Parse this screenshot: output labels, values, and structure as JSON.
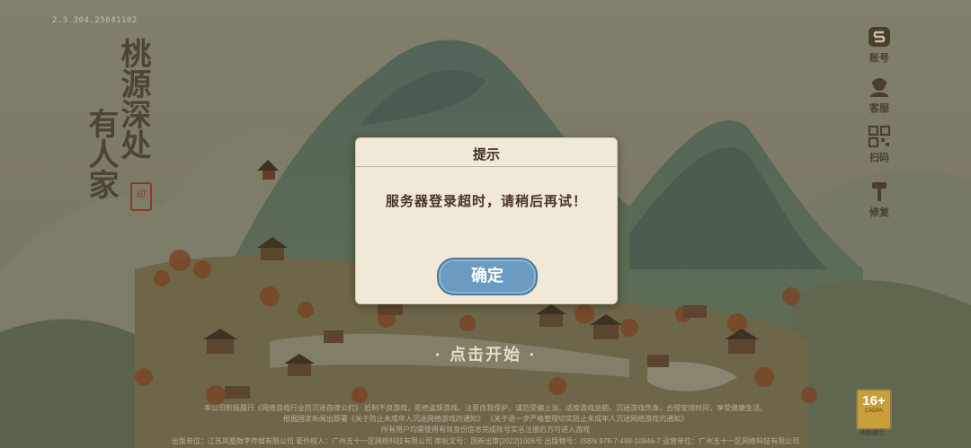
{
  "version": "2.3.304.25041102",
  "logo": {
    "col1": "桃源深处",
    "col2": "有人家",
    "seal": "印"
  },
  "side_menu": [
    {
      "label": "账号",
      "icon": "account-icon"
    },
    {
      "label": "客服",
      "icon": "customer-service-icon"
    },
    {
      "label": "扫码",
      "icon": "qr-code-icon"
    },
    {
      "label": "修复",
      "icon": "repair-hammer-icon"
    }
  ],
  "start_prompt": "· 点击开始 ·",
  "dialog": {
    "title": "提示",
    "message": "服务器登录超时，请稍后再试！",
    "ok_label": "确定"
  },
  "footer": {
    "line1": "本公司积极履行《网络游戏行业防沉迷自律公约》    抵制不良游戏，拒绝盗版游戏。注意自我保护，谨防受骗上当。适度游戏益脑，沉迷游戏伤身。合理安排时间，享受健康生活。",
    "line2": "根据国家新闻出版署《关于防止未成年人沉迷网络游戏的通知》    《关于进一步严格管理切实防止未成年人沉迷网络游戏的通知》",
    "line3": "所有用户均需使用有效身份信息完成账号实名注册后方可进入游戏",
    "line4": "出版单位：江苏凤凰数字传媒有限公司    著作权人：广州五十一区网络科技有限公司    审批文号：国新出审[2022]1005号    出版物号：ISBN 978-7-498-10846-7    运营单位：广州五十一区网络科技有限公司"
  },
  "age_rating": {
    "value": "16+",
    "sub": "CADPA",
    "caption": "适龄提示"
  }
}
